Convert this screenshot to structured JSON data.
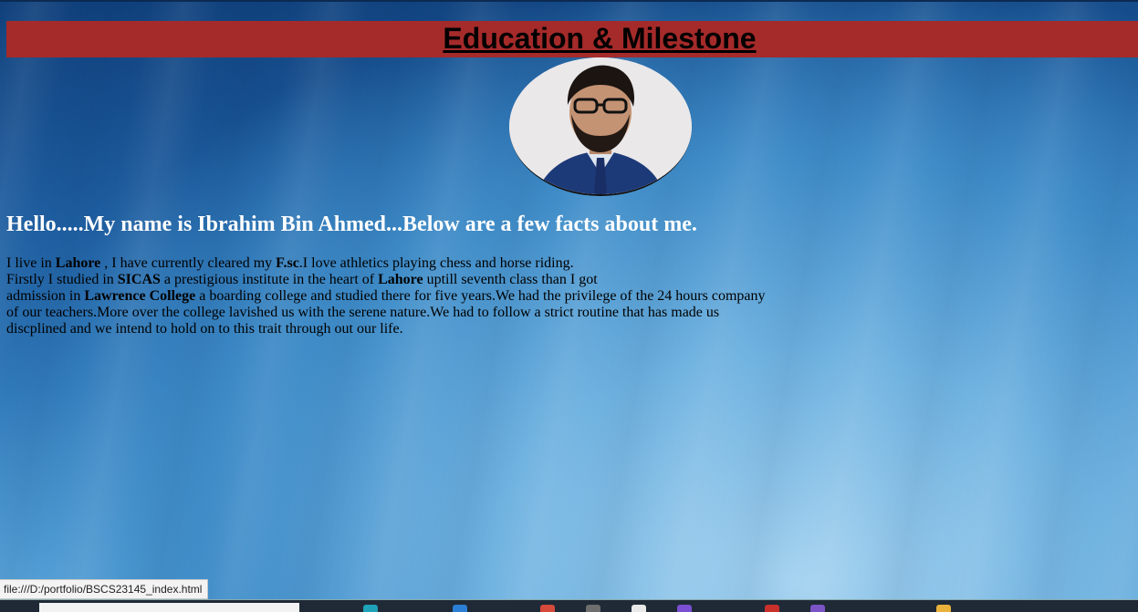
{
  "header": {
    "title": "Education & Milestone",
    "bar_color": "#a52a2a"
  },
  "profile": {
    "photo_alt": "profile-photo"
  },
  "intro": {
    "greeting": "Hello.....My name is Ibrahim Bin Ahmed...Below are a few facts about me."
  },
  "bio": {
    "line1_a": "I live in ",
    "line1_city": "Lahore",
    "line1_b": " , I have currently cleared my ",
    "line1_degree": "F.sc",
    "line1_c": ".I love athletics playing chess and horse riding.",
    "line2_a": "Firstly I studied in ",
    "line2_school": "SICAS",
    "line2_b": " a prestigious institute in the heart of ",
    "line2_city": "Lahore",
    "line2_c": " uptill seventh class than I got",
    "line3_a": "admission in ",
    "line3_college": "Lawrence College",
    "line3_b": " a boarding college and studied there for five years.We had the privilege of the 24 hours company",
    "line4": "of our teachers.More over the college lavished us with the serene nature.We had to follow a strict routine that has made us",
    "line5": "discplined and we intend to hold on to this trait through out our life."
  },
  "status_bar": {
    "url": "file:///D:/portfolio/BSCS23145_index.html"
  },
  "taskbar": {
    "apps": [
      {
        "icon": "edge-icon",
        "color": "#1fa3b8"
      },
      {
        "icon": "file-explorer-icon",
        "color": "#2b7fd4"
      },
      {
        "icon": "chrome-icon",
        "color": "#d64a3c"
      },
      {
        "icon": "mail-icon",
        "color": "#6e6e6e"
      },
      {
        "icon": "app-icon",
        "color": "#e8e8e8"
      },
      {
        "icon": "vscode-icon",
        "color": "#7a4fd1"
      },
      {
        "icon": "opera-icon",
        "color": "#c9302c"
      },
      {
        "icon": "viber-icon",
        "color": "#7b54c6"
      },
      {
        "icon": "chrome-alt-icon",
        "color": "#e9b23a"
      }
    ]
  }
}
